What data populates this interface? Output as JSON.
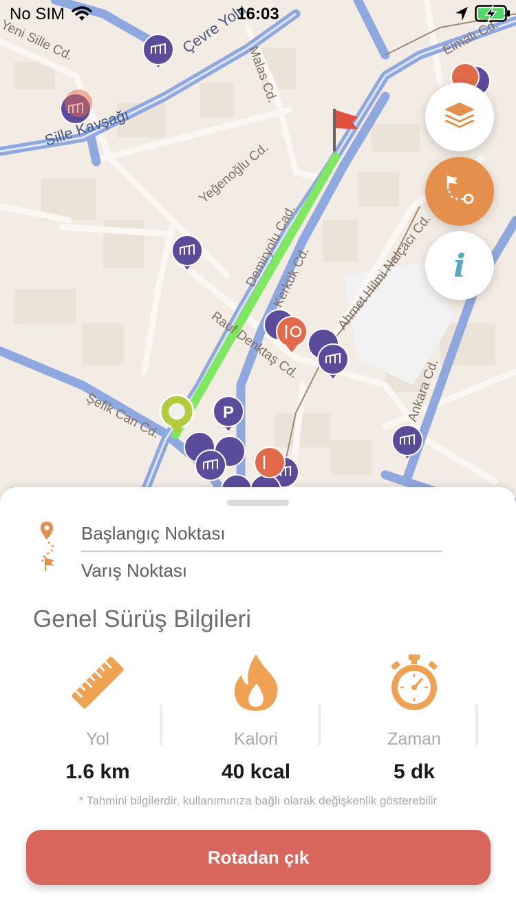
{
  "status_bar": {
    "carrier": "No SIM",
    "time": "16:03",
    "icons": [
      "wifi-icon",
      "location-arrow-icon",
      "battery-charging-icon"
    ]
  },
  "map": {
    "street_labels": {
      "sille_cd": "Yeni Sille Cd.",
      "cevre_yolu": "Çevre Yolu",
      "malas": "Malas Cd.",
      "elmali": "Elmalı Cd.",
      "sille_kavsagi": "Sille Kavşağı",
      "yegenoglu": "Yeğenoğlu Cd.",
      "demiryolu": "Demiryolu Cad.",
      "kerkuk": "Kerkük Cd.",
      "ahmet": "Ahmet Hilmi Nalçacı Cd.",
      "rauf": "Rauf Denktaş Cd.",
      "sefik": "Şefik Can Cd.",
      "ankara": "Ankara Cd."
    },
    "parking_letter": "P",
    "colors": {
      "route": "#7ee85f",
      "road": "#8fa8e0",
      "marker_purple": "#5b4b9b",
      "marker_orange": "#e06a4a"
    }
  },
  "fab_buttons": {
    "layers_icon": "layers-icon",
    "route_icon": "route-flag-pin-icon",
    "info_glyph": "i"
  },
  "sheet": {
    "start_label": "Başlangıç Noktası",
    "end_label": "Varış Noktası",
    "section_title": "Genel Sürüş Bilgileri",
    "stats": [
      {
        "icon": "ruler-icon",
        "label": "Yol",
        "value": "1.6 km"
      },
      {
        "icon": "flame-icon",
        "label": "Kalori",
        "value": "40 kcal"
      },
      {
        "icon": "stopwatch-icon",
        "label": "Zaman",
        "value": "5 dk"
      }
    ],
    "note": "* Tahmini bilgilerdir, kullanımınıza bağlı olarak değişkenlik gösterebilir",
    "exit_button": "Rotadan çık",
    "accent": "#e58f4d",
    "button_color": "#d9665d"
  }
}
